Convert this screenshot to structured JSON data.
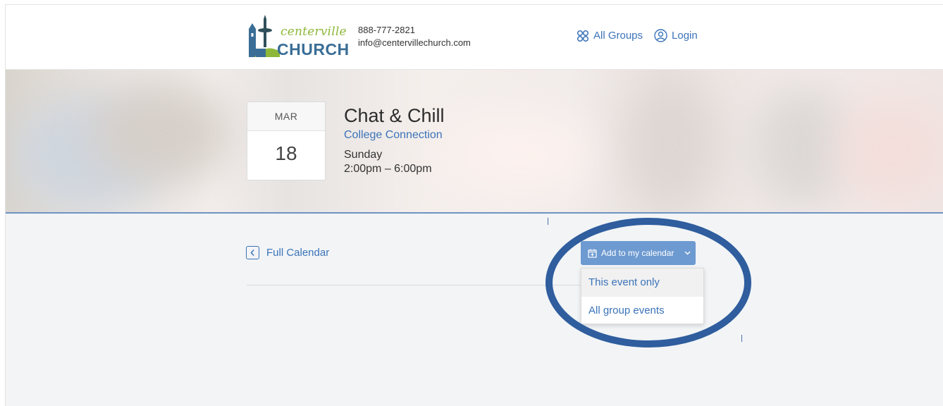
{
  "header": {
    "logo": {
      "top": "centerville",
      "bottom": "CHURCH"
    },
    "phone": "888-777-2821",
    "email": "info@centervillechurch.com",
    "nav": [
      {
        "label": "All Groups",
        "icon": "groups-icon"
      },
      {
        "label": "Login",
        "icon": "user-icon"
      }
    ]
  },
  "event": {
    "month": "MAR",
    "day": "18",
    "title": "Chat & Chill",
    "group": "College Connection",
    "weekday": "Sunday",
    "time": "2:00pm – 6:00pm"
  },
  "actions": {
    "back_label": "Full Calendar",
    "add_calendar_label": "Add to my calendar",
    "dropdown": [
      "This event only",
      "All group events"
    ]
  },
  "colors": {
    "link": "#3b73b9",
    "button": "#6d9ad0",
    "logo_green": "#8db83a",
    "logo_blue": "#3a6e96",
    "annotation": "#2f5d9e"
  }
}
